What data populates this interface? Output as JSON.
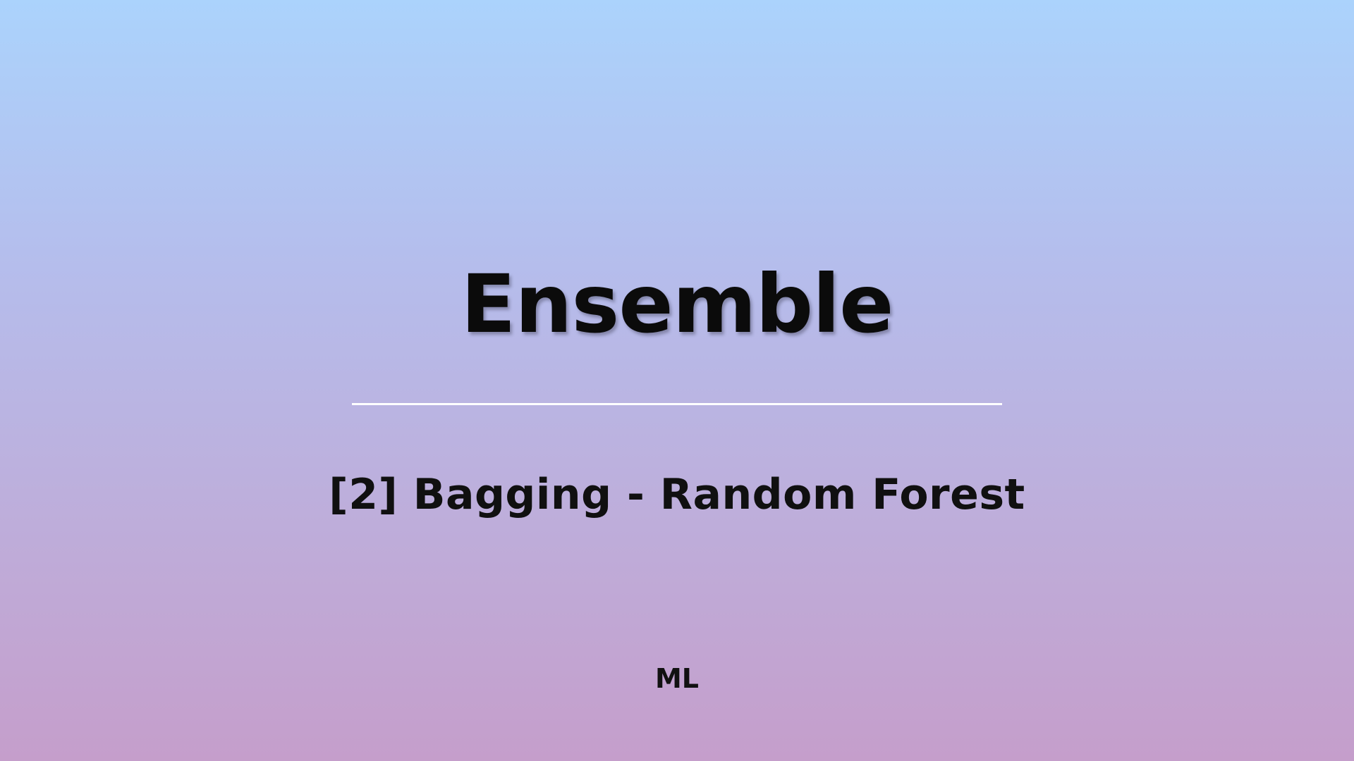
{
  "slide": {
    "title": "Ensemble",
    "subtitle": "[2] Bagging - Random Forest",
    "footer": "ML"
  },
  "colors": {
    "background_top": "#abd3fc",
    "background_bottom": "#c59ecb",
    "divider": "#ffffff",
    "text": "#0b0b0b"
  }
}
